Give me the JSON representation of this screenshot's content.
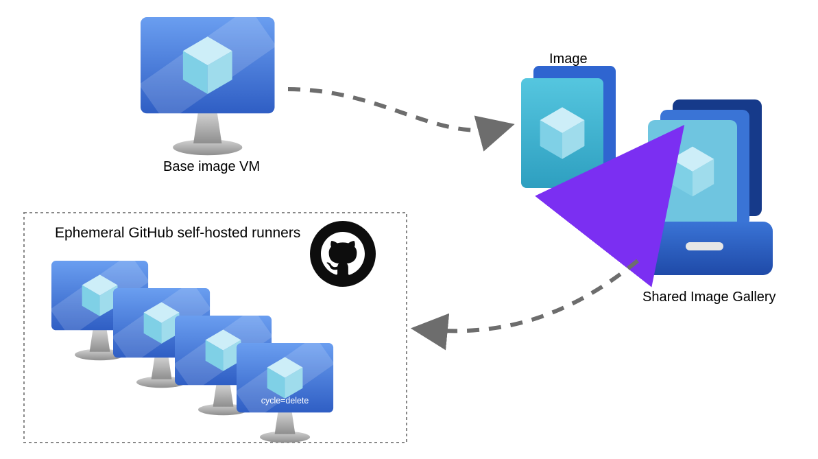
{
  "labels": {
    "base_vm": "Base image VM",
    "image": "Image",
    "gallery": "Shared Image Gallery",
    "runners_box": "Ephemeral GitHub self-hosted runners",
    "vm_tag": "cycle=delete"
  },
  "icons": {
    "base_vm": "vm-cube-icon",
    "image_card": "disk-image-icon",
    "gallery": "image-gallery-drawer-icon",
    "github": "github-octocat-icon",
    "runner_vm": "vm-cube-icon"
  },
  "arrows": {
    "vm_to_image": "dashed",
    "image_to_gallery": "solid",
    "gallery_to_runners": "dashed"
  },
  "colors": {
    "vm_screen_top": "#5a8ee6",
    "vm_screen_bottom": "#2f5ec4",
    "vm_stand": "#b0b0b0",
    "cube_light": "#aee3f2",
    "cube_mid": "#7fd0e6",
    "cube_dark": "#4aa8c8",
    "image_card_front": "#3fb9d6",
    "image_card_back": "#2f65d0",
    "gallery_drawer": "#2f65d0",
    "gallery_dark": "#1a3a8a",
    "gallery_mid": "#3a74d6",
    "gallery_light": "#6fc5e0",
    "arrow_purple": "#7b2ff2",
    "arrow_grey": "#6d6d6d",
    "github_black": "#0d0d0d",
    "box_border": "#888888"
  }
}
